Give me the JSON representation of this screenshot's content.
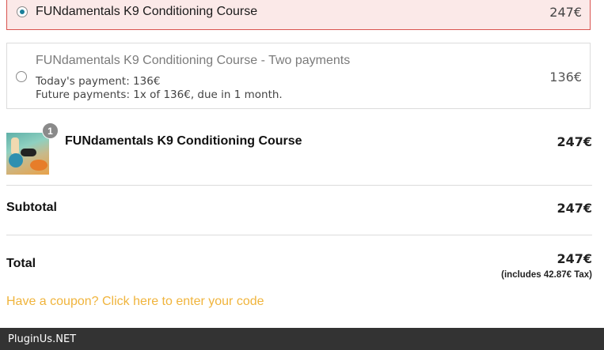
{
  "payment_options": [
    {
      "title": "FUNdamentals K9 Conditioning Course",
      "price": "247€",
      "selected": true
    },
    {
      "title": "FUNdamentals K9 Conditioning Course - Two payments",
      "today_payment": "Today's payment: 136€",
      "future_payments": "Future payments: 1x of 136€, due in 1 month.",
      "price": "136€",
      "selected": false
    }
  ],
  "order": {
    "items": [
      {
        "quantity": "1",
        "name": "FUNdamentals K9 Conditioning Course",
        "price": "247€"
      }
    ],
    "subtotal_label": "Subtotal",
    "subtotal_value": "247€",
    "total_label": "Total",
    "total_value": "247€",
    "tax_note": "(includes 42.87€ Tax)"
  },
  "coupon_link": "Have a coupon? Click here to enter your code",
  "footer": {
    "brand": "PluginUs.NET"
  },
  "colors": {
    "selected_bg": "#fbe9e8",
    "selected_border": "#d9534f",
    "radio_dot": "#1a7f9a",
    "coupon_link": "#f0b43c",
    "footer_bg": "#333333"
  }
}
